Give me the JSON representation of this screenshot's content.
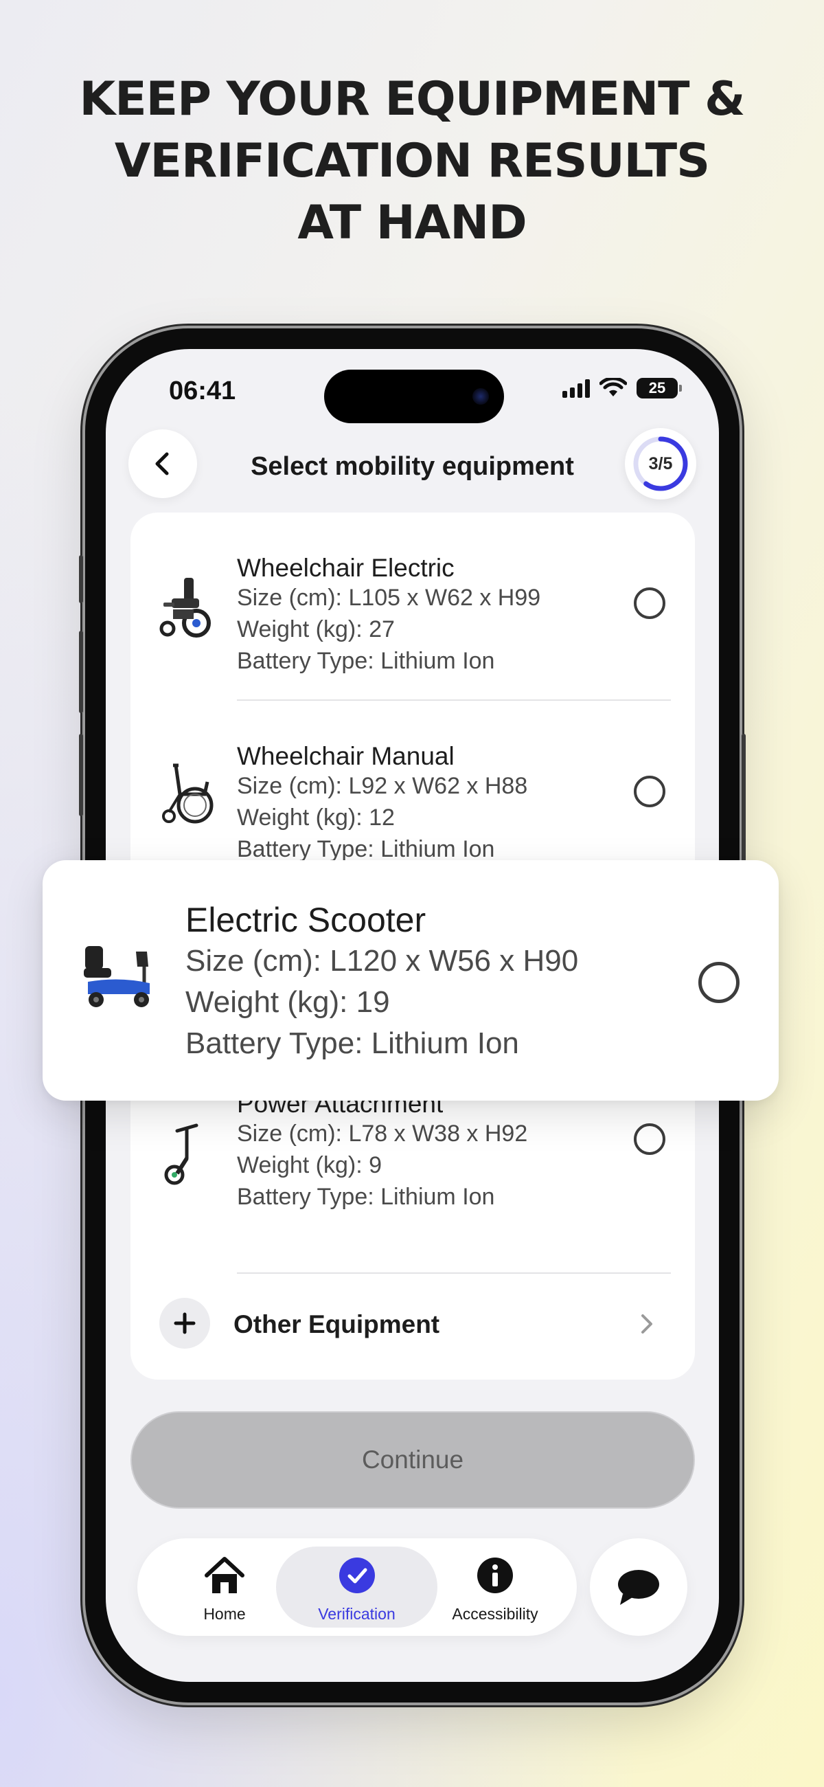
{
  "headline": {
    "line1": "KEEP YOUR EQUIPMENT &",
    "line2": "VERIFICATION RESULTS",
    "line3": "AT HAND"
  },
  "status_bar": {
    "time": "06:41",
    "battery": "25"
  },
  "header": {
    "title": "Select mobility equipment",
    "progress_label": "3/5",
    "progress_fraction": 0.6
  },
  "equipment": [
    {
      "name": "Wheelchair Electric",
      "size": "Size (cm): L105 x W62 x H99",
      "weight": "Weight (kg): 27",
      "battery": "Battery Type: Lithium Ion",
      "icon": "electric-wheelchair-icon",
      "selected": false
    },
    {
      "name": "Wheelchair Manual",
      "size": "Size (cm): L92 x W62 x H88",
      "weight": "Weight (kg): 12",
      "battery": "Battery Type: Lithium Ion",
      "icon": "manual-wheelchair-icon",
      "selected": false
    },
    {
      "name": "Electric Scooter",
      "size": "Size (cm): L120 x W56 x H90",
      "weight": "Weight (kg): 19",
      "battery": "Battery Type: Lithium Ion",
      "icon": "electric-scooter-icon",
      "selected": false
    },
    {
      "name": "Power Attachment",
      "size": "Size (cm): L78 x W38 x H92",
      "weight": "Weight (kg): 9",
      "battery": "Battery Type: Lithium Ion",
      "icon": "power-attachment-icon",
      "selected": false
    }
  ],
  "other_equipment": {
    "label": "Other Equipment"
  },
  "continue_button": {
    "label": "Continue"
  },
  "tabs": [
    {
      "label": "Home",
      "icon": "home-icon"
    },
    {
      "label": "Verification",
      "icon": "check-circle-icon",
      "active": true
    },
    {
      "label": "Accessibility",
      "icon": "info-icon"
    }
  ],
  "chat": {
    "icon": "chat-bubble-icon"
  },
  "colors": {
    "accent": "#3a3ae0",
    "continue_disabled": "#b9b9bb",
    "background_yellow": "#fbf7c8",
    "background_lavender": "#d6d6fa"
  }
}
